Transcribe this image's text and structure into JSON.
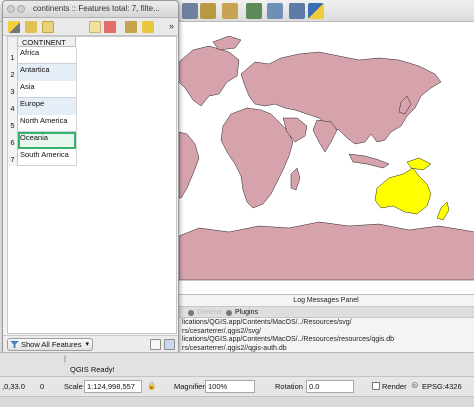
{
  "main_window": {
    "toolbar_icons": [
      "arrow-cursor-icon",
      "layer-icon",
      "lock-icon",
      "refresh-icon",
      "export-icon",
      "table-icon",
      "python-icon"
    ]
  },
  "attribute_table": {
    "title": "continents :: Features total: 7, filte...",
    "toolbar_icons": [
      "pencil-icon",
      "save-icon",
      "select-icon",
      "copy-icon",
      "delete-icon",
      "zoom-icon",
      "field-calculator-icon"
    ],
    "column_header": "CONTINENT",
    "rows": [
      {
        "num": "1",
        "value": "Africa"
      },
      {
        "num": "2",
        "value": "Antartica"
      },
      {
        "num": "3",
        "value": "Asia"
      },
      {
        "num": "4",
        "value": "Europe"
      },
      {
        "num": "5",
        "value": "North America"
      },
      {
        "num": "6",
        "value": "Oceania"
      },
      {
        "num": "7",
        "value": "South America"
      }
    ],
    "selected_row": 6,
    "filter_label": "Show All Features"
  },
  "log_panel": {
    "title": "Log Messages Panel",
    "tabs": [
      "General",
      "Plugins"
    ],
    "lines": [
      "lications/QGIS.app/Contents/MacOS/../Resources/svg/",
      "rs/cesarterrer/.qgis2//svg/",
      "lications/QGIS.app/Contents/MacOS/../Resources/resources/qgis.db",
      "rs/cesarterrer/.qgis2//qgis-auth.db",
      "QGIS Ready!"
    ]
  },
  "status_bar": {
    "coordinate": ",0,33.0",
    "message_number": "0",
    "scale_label": "Scale",
    "scale_value": "1:124,998,557",
    "magnifier_label": "Magnifier",
    "magnifier_value": "100%",
    "rotation_label": "Rotation",
    "rotation_value": "0.0",
    "render_label": "Render",
    "crs": "EPSG:4326"
  },
  "colors": {
    "land": "#d6a3ad",
    "selected_feature": "#ffff00",
    "selection_outline": "#36b26b"
  }
}
